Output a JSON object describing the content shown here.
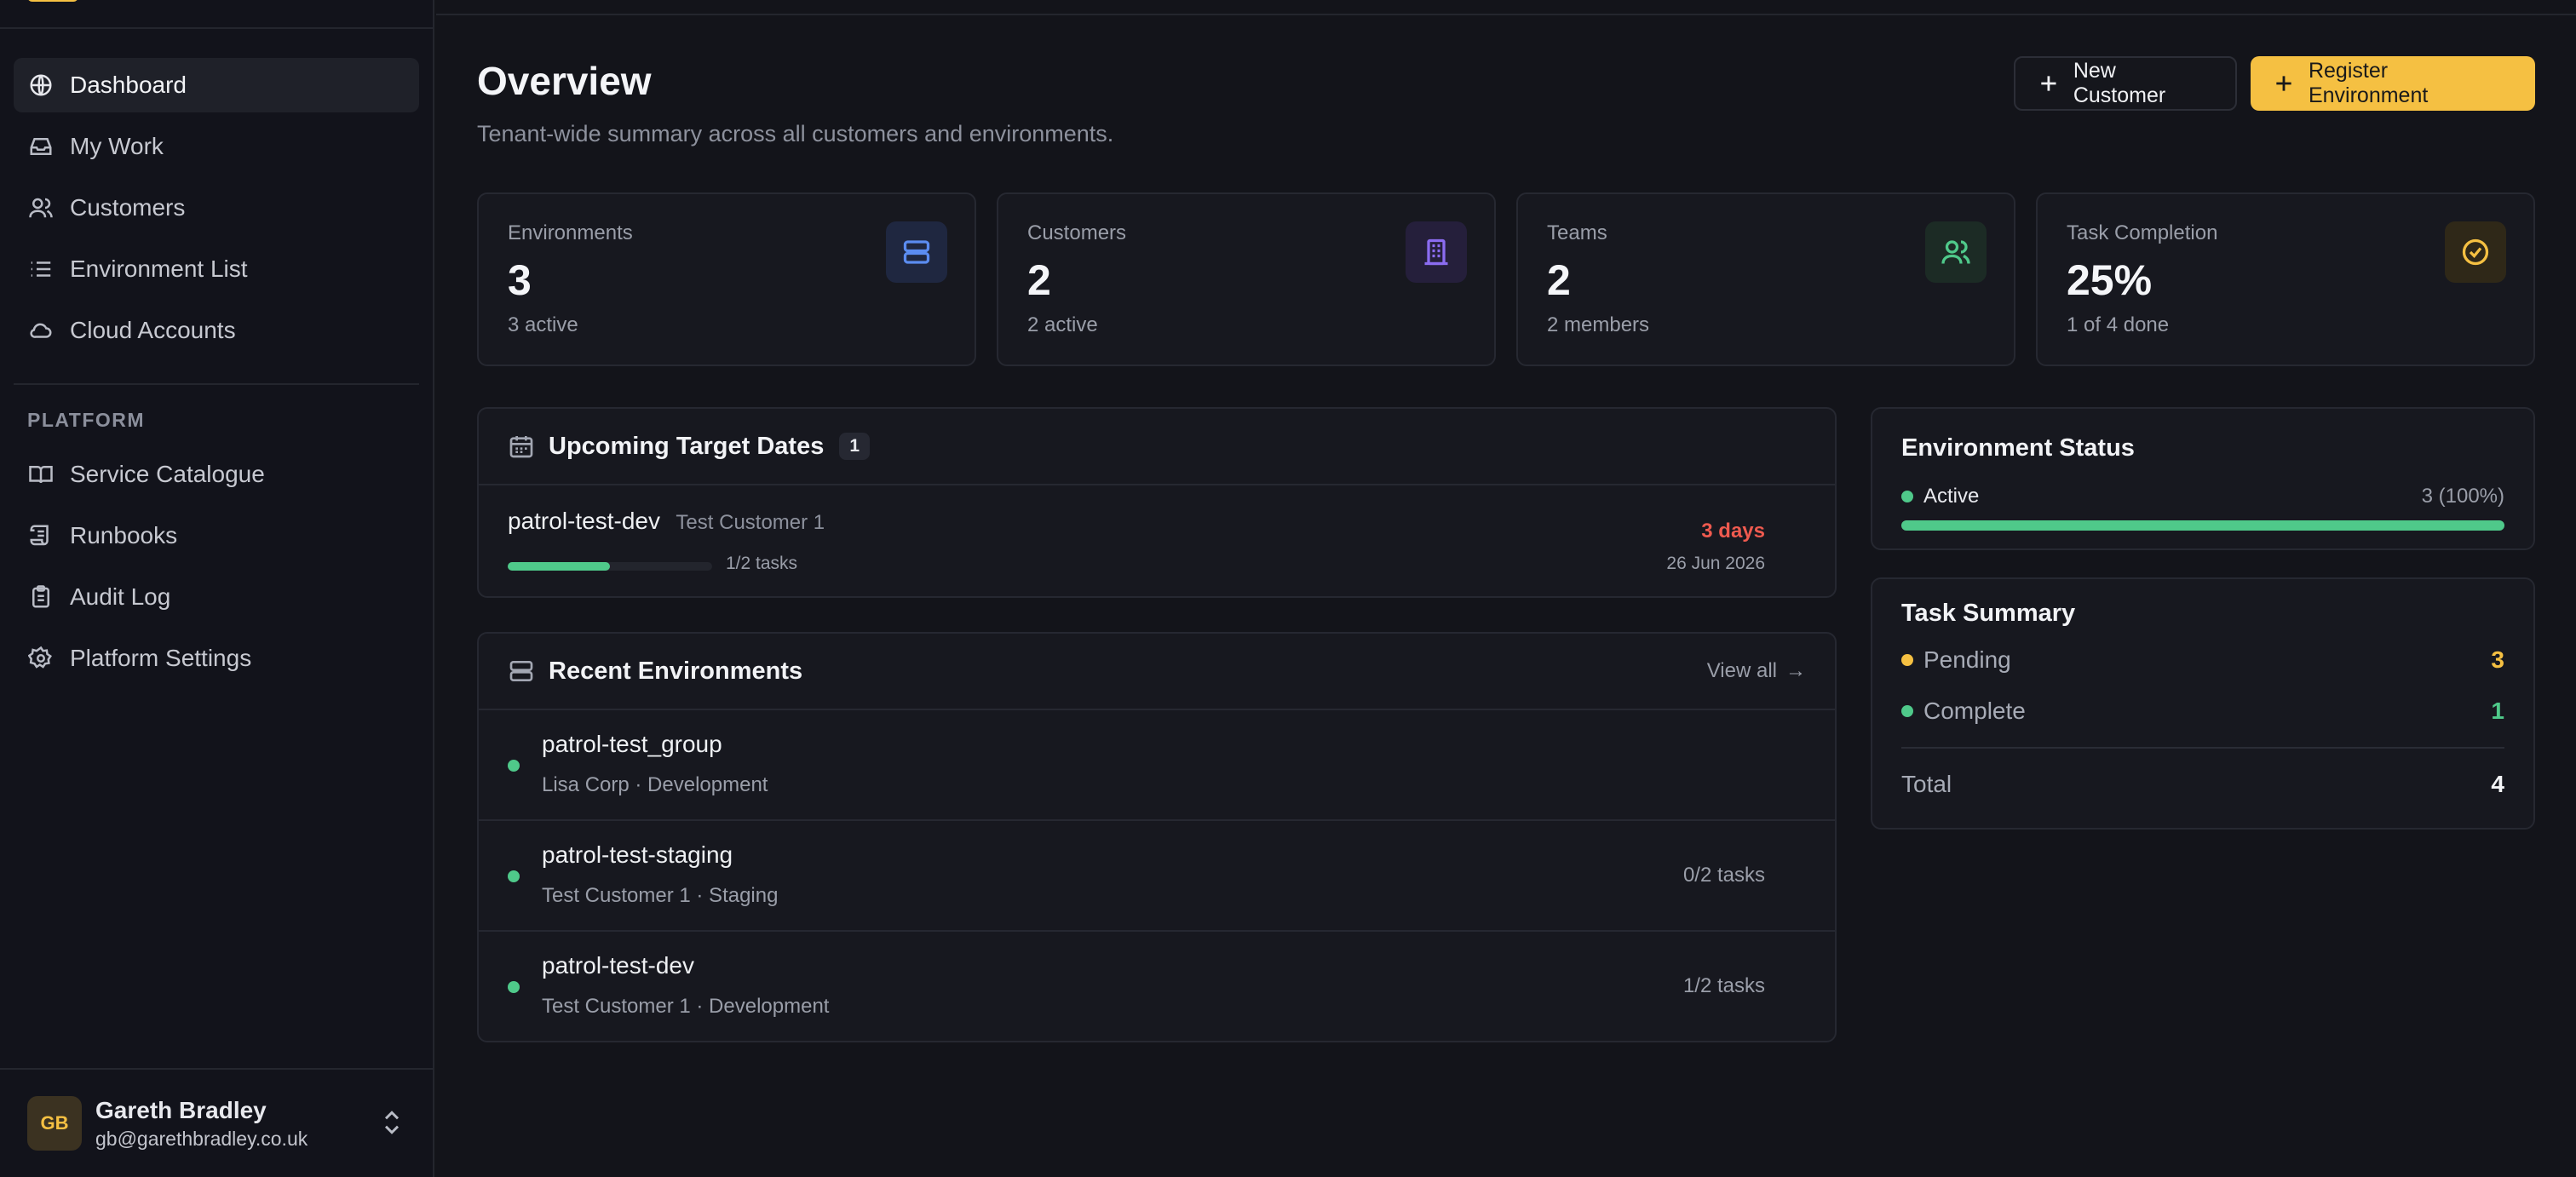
{
  "sidebar": {
    "nav": [
      {
        "label": "Dashboard",
        "icon": "globe-icon"
      },
      {
        "label": "My Work",
        "icon": "inbox-icon"
      },
      {
        "label": "Customers",
        "icon": "users-icon"
      },
      {
        "label": "Environment List",
        "icon": "list-icon"
      },
      {
        "label": "Cloud Accounts",
        "icon": "cloud-icon"
      }
    ],
    "section_label": "PLATFORM",
    "platform": [
      {
        "label": "Service Catalogue",
        "icon": "book-icon"
      },
      {
        "label": "Runbooks",
        "icon": "scroll-icon"
      },
      {
        "label": "Audit Log",
        "icon": "clipboard-icon"
      },
      {
        "label": "Platform Settings",
        "icon": "gear-icon"
      }
    ],
    "user": {
      "initials": "GB",
      "name": "Gareth Bradley",
      "email": "gb@garethbradley.co.uk"
    }
  },
  "header": {
    "title": "Overview",
    "subtitle": "Tenant-wide summary across all customers and environments.",
    "new_customer": "New Customer",
    "register_environment": "Register Environment"
  },
  "stats": [
    {
      "label": "Environments",
      "value": "3",
      "sub": "3 active",
      "icon": "server-icon",
      "color": "#5b8cf0"
    },
    {
      "label": "Customers",
      "value": "2",
      "sub": "2 active",
      "icon": "building-icon",
      "color": "#8b6cf0"
    },
    {
      "label": "Teams",
      "value": "2",
      "sub": "2 members",
      "icon": "users-icon",
      "color": "#4fc98a"
    },
    {
      "label": "Task Completion",
      "value": "25%",
      "sub": "1 of 4 done",
      "icon": "check-circle-icon",
      "color": "#f5c042"
    }
  ],
  "upcoming": {
    "title": "Upcoming Target Dates",
    "count": "1",
    "items": [
      {
        "name": "patrol-test-dev",
        "customer": "Test Customer 1",
        "tasks": "1/2 tasks",
        "progress": 0.5,
        "due": "3 days",
        "date": "26 Jun 2026"
      }
    ]
  },
  "recent": {
    "title": "Recent Environments",
    "view_all": "View all",
    "items": [
      {
        "name": "patrol-test_group",
        "meta": "Lisa Corp · Development",
        "tasks": ""
      },
      {
        "name": "patrol-test-staging",
        "meta": "Test Customer 1 · Staging",
        "tasks": "0/2 tasks"
      },
      {
        "name": "patrol-test-dev",
        "meta": "Test Customer 1 · Development",
        "tasks": "1/2 tasks"
      }
    ]
  },
  "env_status": {
    "title": "Environment Status",
    "label": "Active",
    "value": "3 (100%)",
    "fraction": 1.0,
    "color": "#4fc98a"
  },
  "task_summary": {
    "title": "Task Summary",
    "pending_label": "Pending",
    "pending_value": "3",
    "complete_label": "Complete",
    "complete_value": "1",
    "total_label": "Total",
    "total_value": "4",
    "pending_color": "#f5c042",
    "complete_color": "#4fc98a"
  }
}
